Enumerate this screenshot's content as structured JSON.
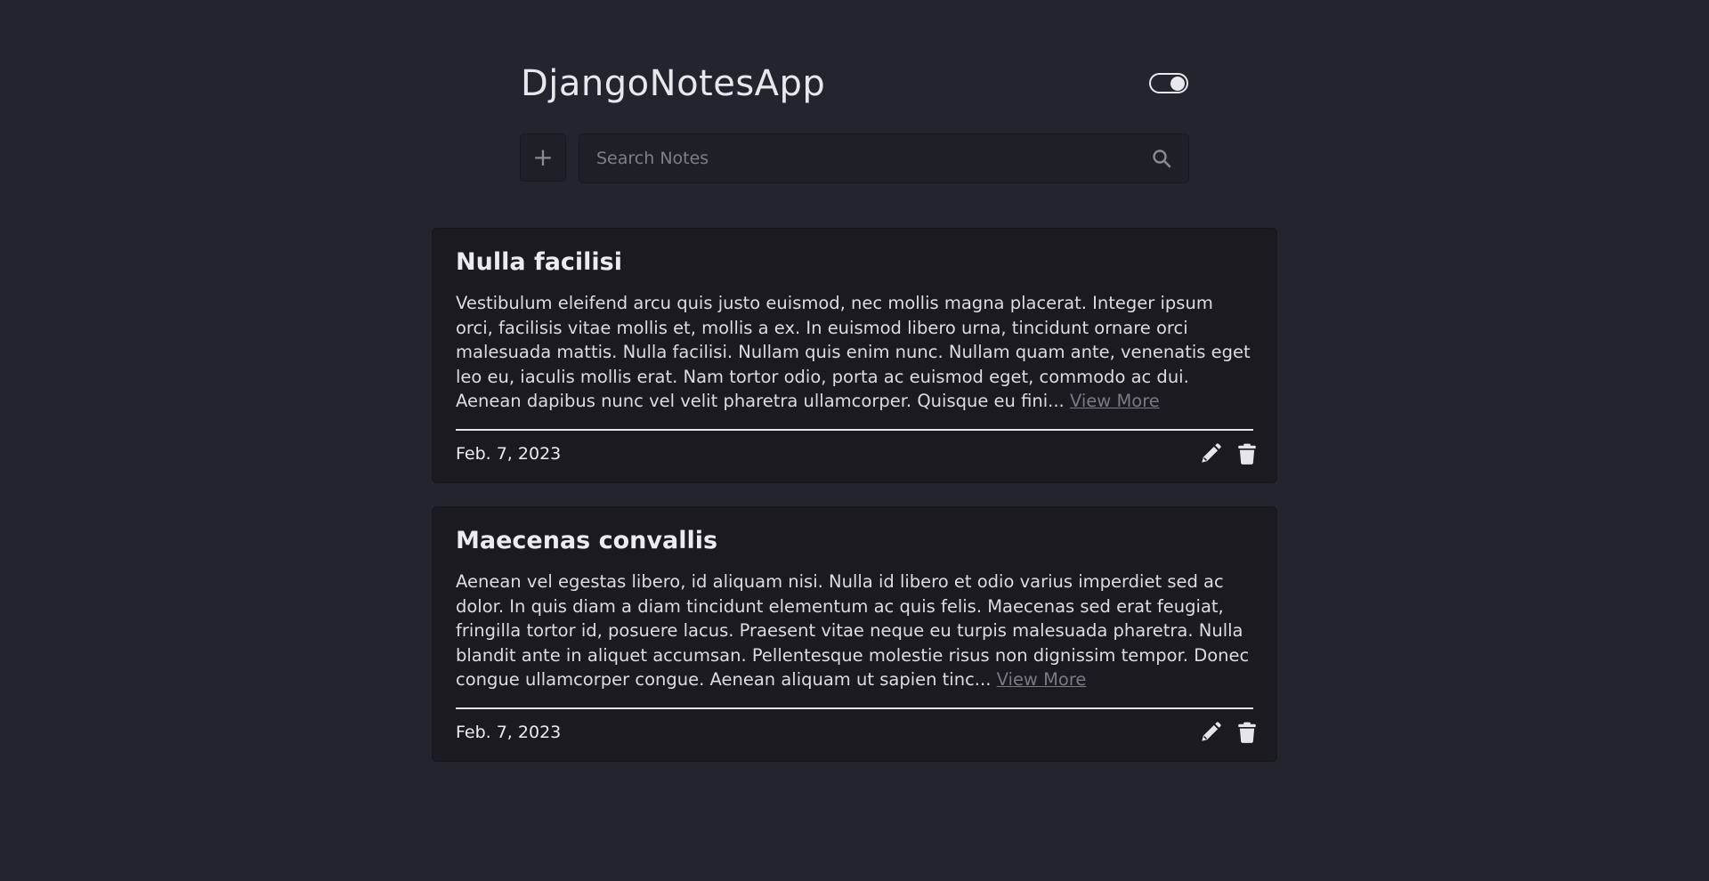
{
  "header": {
    "title": "DjangoNotesApp",
    "theme_toggle": "on"
  },
  "toolbar": {
    "add_label": "+",
    "search": {
      "placeholder": "Search Notes",
      "value": ""
    }
  },
  "notes": [
    {
      "title": "Nulla facilisi",
      "body": "Vestibulum eleifend arcu quis justo euismod, nec mollis magna placerat. Integer ipsum orci, facilisis vitae mollis et, mollis a ex. In euismod libero urna, tincidunt ornare orci malesuada mattis. Nulla facilisi. Nullam quis enim nunc. Nullam quam ante, venenatis eget leo eu, iaculis mollis erat. Nam tortor odio, porta ac euismod eget, commodo ac dui. Aenean dapibus nunc vel velit pharetra ullamcorper. Quisque eu fini... ",
      "view_more": "View More",
      "date": "Feb. 7, 2023"
    },
    {
      "title": "Maecenas convallis",
      "body": "Aenean vel egestas libero, id aliquam nisi. Nulla id libero et odio varius imperdiet sed ac dolor. In quis diam a diam tincidunt elementum ac quis felis. Maecenas sed erat feugiat, fringilla tortor id, posuere lacus. Praesent vitae neque eu turpis malesuada pharetra. Nulla blandit ante in aliquet accumsan. Pellentesque molestie risus non dignissim tempor. Donec congue ullamcorper congue. Aenean aliquam ut sapien tinc... ",
      "view_more": "View More",
      "date": "Feb. 7, 2023"
    }
  ],
  "icons": {
    "add": "plus-icon",
    "search": "search-icon",
    "edit": "pencil-icon",
    "delete": "trash-icon"
  },
  "colors": {
    "background": "#24242e",
    "card": "#1b1a20",
    "text": "#e6e6ea",
    "muted": "#7a7a84"
  }
}
